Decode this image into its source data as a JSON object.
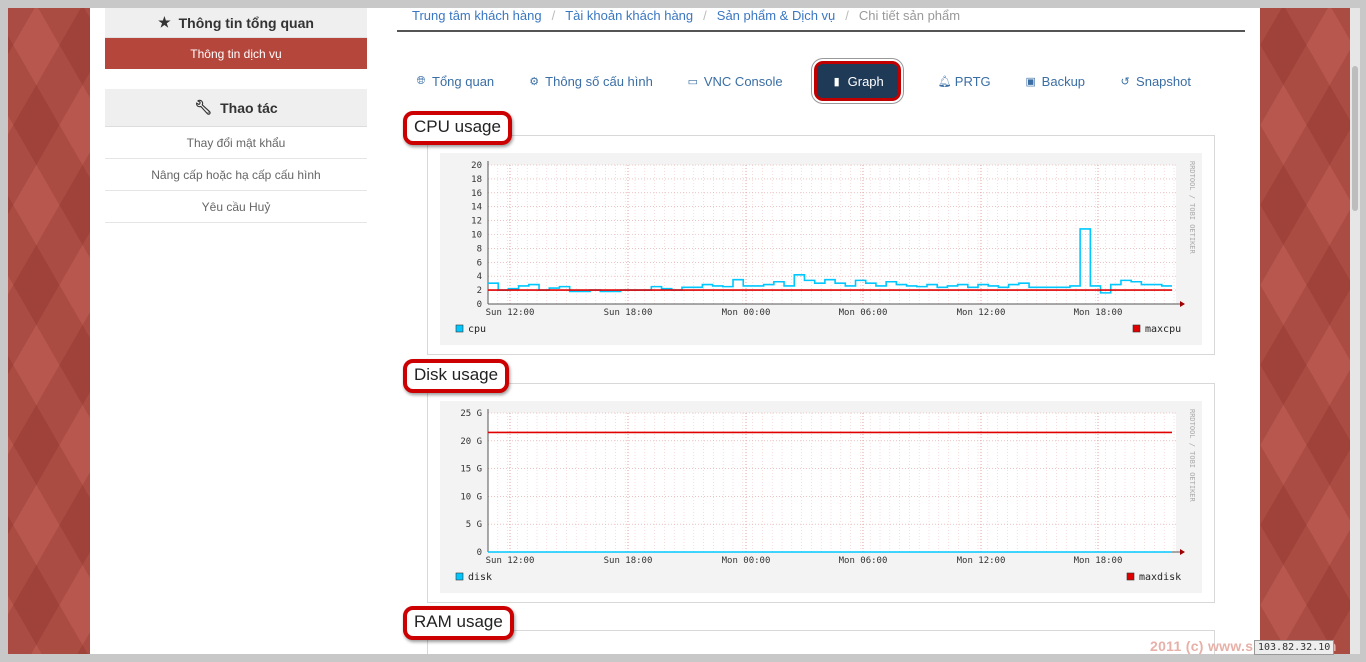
{
  "sidebar": {
    "overview_title": "Thông tin tổng quan",
    "active_item": "Thông tin dịch vụ",
    "actions_title": "Thao tác",
    "actions": [
      "Thay đổi mật khẩu",
      "Nâng cấp hoặc hạ cấp cấu hình",
      "Yêu cầu Huỷ"
    ]
  },
  "breadcrumb": [
    "Trung tâm khách hàng",
    "Tài khoản khách hàng",
    "Sản phẩm & Dịch vụ",
    "Chi tiết sản phẩm"
  ],
  "tabs": [
    {
      "label": "Tổng quan",
      "icon": "globe-icon"
    },
    {
      "label": "Thông số cấu hình",
      "icon": "cogs-icon"
    },
    {
      "label": "VNC Console",
      "icon": "monitor-icon"
    },
    {
      "label": "Graph",
      "icon": "bar-chart-icon",
      "active": true
    },
    {
      "label": "PRTG",
      "icon": "bell-icon"
    },
    {
      "label": "Backup",
      "icon": "floppy-icon"
    },
    {
      "label": "Snapshot",
      "icon": "history-icon"
    }
  ],
  "panels": {
    "cpu_title": "CPU usage",
    "disk_title": "Disk usage",
    "ram_title": "RAM usage"
  },
  "watermark": "RRDTOOL / TOBI OETIKER",
  "colors": {
    "accent": "#b5463c",
    "active_tab": "#1e3a57",
    "line_series": "#00c8ff",
    "max_series": "#e00000"
  },
  "chart_data": [
    {
      "type": "line",
      "title": "CPU usage",
      "x_ticks": [
        "Sun 12:00",
        "Sun 18:00",
        "Mon 00:00",
        "Mon 06:00",
        "Mon 12:00",
        "Mon 18:00"
      ],
      "y_ticks": [
        "0",
        "2",
        "4",
        "6",
        "8",
        "10",
        "12",
        "14",
        "16",
        "18",
        "20"
      ],
      "ylim": [
        0,
        20
      ],
      "series": [
        {
          "name": "cpu",
          "color": "#00c8ff",
          "values": [
            3,
            2,
            2.2,
            2.6,
            2.8,
            2,
            2.3,
            2.5,
            1.8,
            1.8,
            2,
            1.8,
            1.8,
            2,
            2,
            2,
            2.5,
            2.2,
            2,
            2.4,
            2.4,
            2.8,
            2.6,
            2.5,
            3.5,
            2.6,
            2.6,
            2.8,
            3.2,
            2.6,
            4.2,
            3.4,
            3,
            3.5,
            3,
            2.6,
            3.4,
            3,
            2.6,
            3.2,
            2.8,
            2.6,
            2.5,
            2.8,
            2.4,
            2.6,
            2.8,
            2.4,
            2.8,
            2.6,
            2.4,
            2.8,
            3,
            2.4,
            2.4,
            2.4,
            2.4,
            2.6,
            10.8,
            2.6,
            1.6,
            2.8,
            3.4,
            3.2,
            2.8,
            2.8,
            2.6
          ]
        },
        {
          "name": "maxcpu",
          "color": "#e00000",
          "values": [
            2,
            2,
            2,
            2,
            2,
            2,
            2,
            2,
            2,
            2,
            2,
            2,
            2,
            2,
            2,
            2,
            2,
            2,
            2,
            2,
            2,
            2,
            2,
            2,
            2,
            2,
            2,
            2,
            2,
            2,
            2,
            2,
            2,
            2,
            2,
            2,
            2,
            2,
            2,
            2,
            2,
            2,
            2,
            2,
            2,
            2,
            2,
            2,
            2,
            2,
            2,
            2,
            2,
            2,
            2,
            2,
            2,
            2,
            2,
            2,
            2,
            2,
            2,
            2,
            2,
            2,
            2
          ]
        }
      ]
    },
    {
      "type": "line",
      "title": "Disk usage",
      "x_ticks": [
        "Sun 12:00",
        "Sun 18:00",
        "Mon 00:00",
        "Mon 06:00",
        "Mon 12:00",
        "Mon 18:00"
      ],
      "y_ticks": [
        "0",
        "5 G",
        "10 G",
        "15 G",
        "20 G",
        "25 G"
      ],
      "ylim": [
        0,
        25
      ],
      "series": [
        {
          "name": "disk",
          "color": "#00c8ff",
          "values": [
            0,
            0
          ]
        },
        {
          "name": "maxdisk",
          "color": "#e00000",
          "values": [
            21.5,
            21.5
          ]
        }
      ]
    }
  ],
  "footer": "2011 (c) www.smarthost.vn",
  "ip_badge": "103.82.32.10"
}
